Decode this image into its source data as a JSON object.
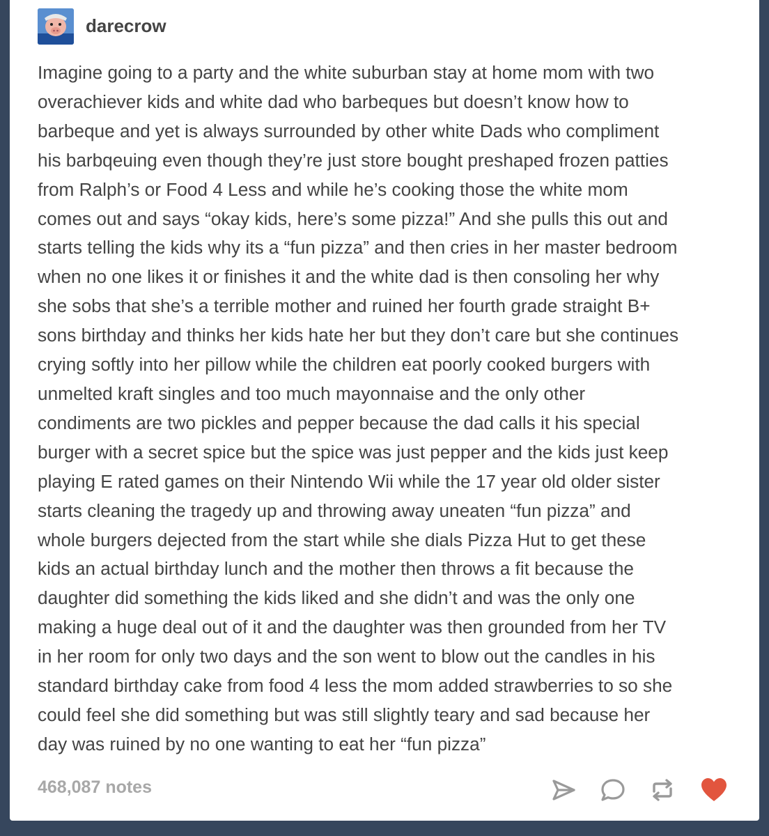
{
  "post": {
    "username": "darecrow",
    "notes": "468,087 notes",
    "lines": [
      "Imagine going to a party and the white suburban stay at home mom with two",
      "overachiever kids and white dad who barbeques but doesn’t know how to",
      "barbeque and yet is always surrounded by other white Dads who compliment",
      "his barbqeuing even though they’re just store bought preshaped frozen patties",
      "from Ralph’s or Food 4 Less and while he’s cooking those the white mom",
      "comes out and says “okay kids, here’s some pizza!” And she pulls this out and",
      "starts telling the kids why its a “fun pizza” and then cries in her master bedroom",
      "when no one likes it or finishes it and the white dad is then consoling her why",
      "she sobs that she’s a terrible mother and ruined her fourth grade straight B+",
      "sons birthday and thinks her kids hate her but they don’t care but she continues",
      "crying softly into her pillow while the children eat poorly cooked burgers with",
      "unmelted kraft singles and too much mayonnaise and the only other",
      "condiments are two pickles and pepper because the dad calls it his special",
      "burger with a secret spice but the spice was just pepper and the kids just keep",
      "playing E rated games on their Nintendo Wii while the 17 year old older sister",
      "starts cleaning the tragedy up and throwing away uneaten “fun pizza” and",
      "whole burgers dejected from the start while she dials Pizza Hut to get these",
      "kids an actual birthday lunch and the mother then throws a fit because the",
      "daughter did something the kids liked and she didn’t and was the only one",
      "making a huge deal out of it and the daughter was then grounded from her TV",
      "in her room for only two days and the son went to blow out the candles in his",
      "standard birthday cake from food 4 less the mom added strawberries to so she",
      "could feel she did something but was still slightly teary and sad because her",
      "day was ruined by no one wanting to eat her “fun pizza”"
    ]
  },
  "actions": [
    {
      "name": "share-icon",
      "color": "#9a9a9a"
    },
    {
      "name": "reply-icon",
      "color": "#9a9a9a"
    },
    {
      "name": "reblog-icon",
      "color": "#9a9a9a"
    },
    {
      "name": "like-heart-icon",
      "color": "#e2553e"
    }
  ],
  "colors": {
    "background": "#36465d",
    "text": "#444444",
    "notes": "#a8a8a8",
    "like": "#e2553e"
  }
}
